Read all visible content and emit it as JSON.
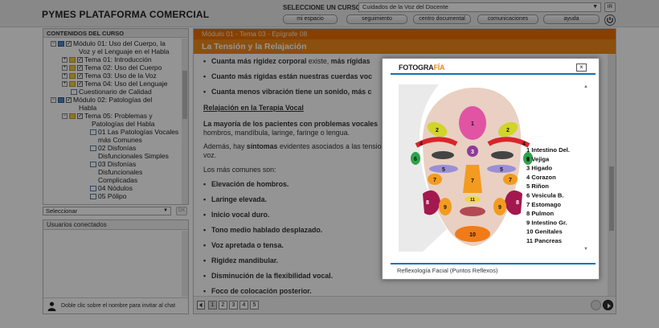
{
  "header": {
    "title": "PYMES PLATAFORMA COMERCIAL",
    "course_label": "SELECCIONE UN CURSO:",
    "course_value": "Cuidados de la Voz del Docente",
    "go_label": "IR",
    "nav": [
      "mi espacio",
      "seguimiento",
      "centro documental",
      "comunicaciones",
      "ayuda"
    ]
  },
  "sidebar": {
    "header": "CONTENIDOS DEL CURSO",
    "tree": [
      {
        "text": "Módulo 01: Uso del Cuerpo, la",
        "type": "module",
        "level": 1,
        "expander": "−"
      },
      {
        "text": "Voz y el Lenguaje en el Habla",
        "type": "cont",
        "level": 1
      },
      {
        "text": "Tema 01: Introducción",
        "type": "topic",
        "level": 2,
        "expander": "+"
      },
      {
        "text": "Tema 02: Uso del Cuerpo",
        "type": "topic",
        "level": 2,
        "expander": "+"
      },
      {
        "text": "Tema 03: Uso de la Voz",
        "type": "topic",
        "level": 2,
        "expander": "+"
      },
      {
        "text": "Tema 04: Uso del Lenguaje",
        "type": "topic",
        "level": 2,
        "expander": "+"
      },
      {
        "text": "Cuestionario de Calidad",
        "type": "doc",
        "level": 2
      },
      {
        "text": "Módulo 02: Patologías del",
        "type": "module",
        "level": 1,
        "expander": "−"
      },
      {
        "text": "Habla",
        "type": "cont",
        "level": 1
      },
      {
        "text": "Tema 05: Problemas y",
        "type": "topic",
        "level": 2,
        "expander": "−"
      },
      {
        "text": "Patologías del Habla",
        "type": "cont",
        "level": 2
      },
      {
        "text": "01 Las Patologías Vocales",
        "type": "doc",
        "level": 3
      },
      {
        "text": "más Comunes",
        "type": "cont",
        "level": 3
      },
      {
        "text": "02 Disfonías",
        "type": "doc",
        "level": 3
      },
      {
        "text": "Disfuncionales Simples",
        "type": "cont",
        "level": 3
      },
      {
        "text": "03 Disfonías",
        "type": "doc",
        "level": 3
      },
      {
        "text": "Disfuncionales",
        "type": "cont",
        "level": 3
      },
      {
        "text": "Complicadas",
        "type": "cont",
        "level": 3
      },
      {
        "text": "04 Nódulos",
        "type": "doc",
        "level": 3
      },
      {
        "text": "05 Pólipo",
        "type": "doc",
        "level": 3
      }
    ],
    "filter_value": "Seleccionar",
    "ok_label": "OK"
  },
  "users": {
    "header": "Usuarios conectados",
    "footer_hint": "Doble clic sobre el nombre para invitar al chat"
  },
  "content": {
    "breadcrumb": "Módulo 01 - Tema 03 - Epígrafe 08",
    "title": "La Tensión y la Relajación",
    "lines": [
      {
        "kind": "bullet",
        "parts": [
          {
            "t": "Cuanta más rigidez corporal",
            "b": true
          },
          {
            "t": " existe, ",
            "b": false
          },
          {
            "t": "más rígidas",
            "b": true
          }
        ]
      },
      {
        "kind": "bullet",
        "parts": [
          {
            "t": "Cuanto más rígidas están nuestras cuerdas voc",
            "b": true
          }
        ]
      },
      {
        "kind": "bullet",
        "parts": [
          {
            "t": "Cuanta menos vibración tiene un sonido, más c",
            "b": true
          }
        ]
      },
      {
        "kind": "heading",
        "parts": [
          {
            "t": "Relajación en la Terapia Vocal",
            "b": true
          }
        ]
      },
      {
        "kind": "para",
        "parts": [
          {
            "t": "La mayoría de los pacientes con problemas vocales",
            "b": true
          }
        ]
      },
      {
        "kind": "para2",
        "parts": [
          {
            "t": "hombros, mandíbula, laringe, faringe o lengua.",
            "b": false
          }
        ]
      },
      {
        "kind": "para",
        "parts": [
          {
            "t": "Además, hay ",
            "b": false
          },
          {
            "t": "síntomas",
            "b": true
          },
          {
            "t": " evidentes asociados a las tensiones",
            "b": false
          }
        ]
      },
      {
        "kind": "para2",
        "parts": [
          {
            "t": "voz.",
            "b": false
          }
        ]
      },
      {
        "kind": "para",
        "parts": [
          {
            "t": "Los más comunes son:",
            "b": false
          }
        ]
      },
      {
        "kind": "bullet",
        "parts": [
          {
            "t": "Elevación de hombros.",
            "b": true
          }
        ]
      },
      {
        "kind": "bullet",
        "parts": [
          {
            "t": "Laringe elevada.",
            "b": true
          }
        ]
      },
      {
        "kind": "bullet",
        "parts": [
          {
            "t": "Inicio vocal duro.",
            "b": true
          }
        ]
      },
      {
        "kind": "bullet",
        "parts": [
          {
            "t": "Tono medio hablado desplazado.",
            "b": true
          }
        ]
      },
      {
        "kind": "bullet",
        "parts": [
          {
            "t": "Voz apretada o tensa.",
            "b": true
          }
        ]
      },
      {
        "kind": "bullet",
        "parts": [
          {
            "t": "Rigidez mandibular.",
            "b": true
          }
        ]
      },
      {
        "kind": "bullet",
        "parts": [
          {
            "t": "Disminución de la flexibilidad vocal.",
            "b": true
          }
        ]
      },
      {
        "kind": "bullet",
        "parts": [
          {
            "t": "Foco de colocación posterior.",
            "b": true
          }
        ]
      }
    ],
    "pages": [
      "1",
      "2",
      "3",
      "4",
      "5"
    ],
    "active_page": "1"
  },
  "modal": {
    "logo_prefix": "FOTOGRA",
    "logo_suffix": "FÍA",
    "close_label": "×",
    "caption": "Reflexología Facial (Puntos Reflexos)",
    "legend": [
      "1 Intestino Del.",
      "2 Vejiga",
      "3 Higado",
      "4 Corazon",
      "5 Riñon",
      "6 Vesicula B.",
      "7 Estomago",
      "8 Pulmon",
      "9 Intestino Gr.",
      "10 Genitales",
      "11 Pancreas"
    ],
    "zone_numbers": [
      "1",
      "2",
      "2",
      "3",
      "4",
      "4",
      "5",
      "5",
      "6",
      "6",
      "7",
      "7",
      "7",
      "8",
      "8",
      "9",
      "9",
      "10",
      "11"
    ],
    "colors": {
      "accent_orange": "#e96f00",
      "title_orange": "#f08a1a",
      "rule_blue": "#0f72ba"
    }
  }
}
